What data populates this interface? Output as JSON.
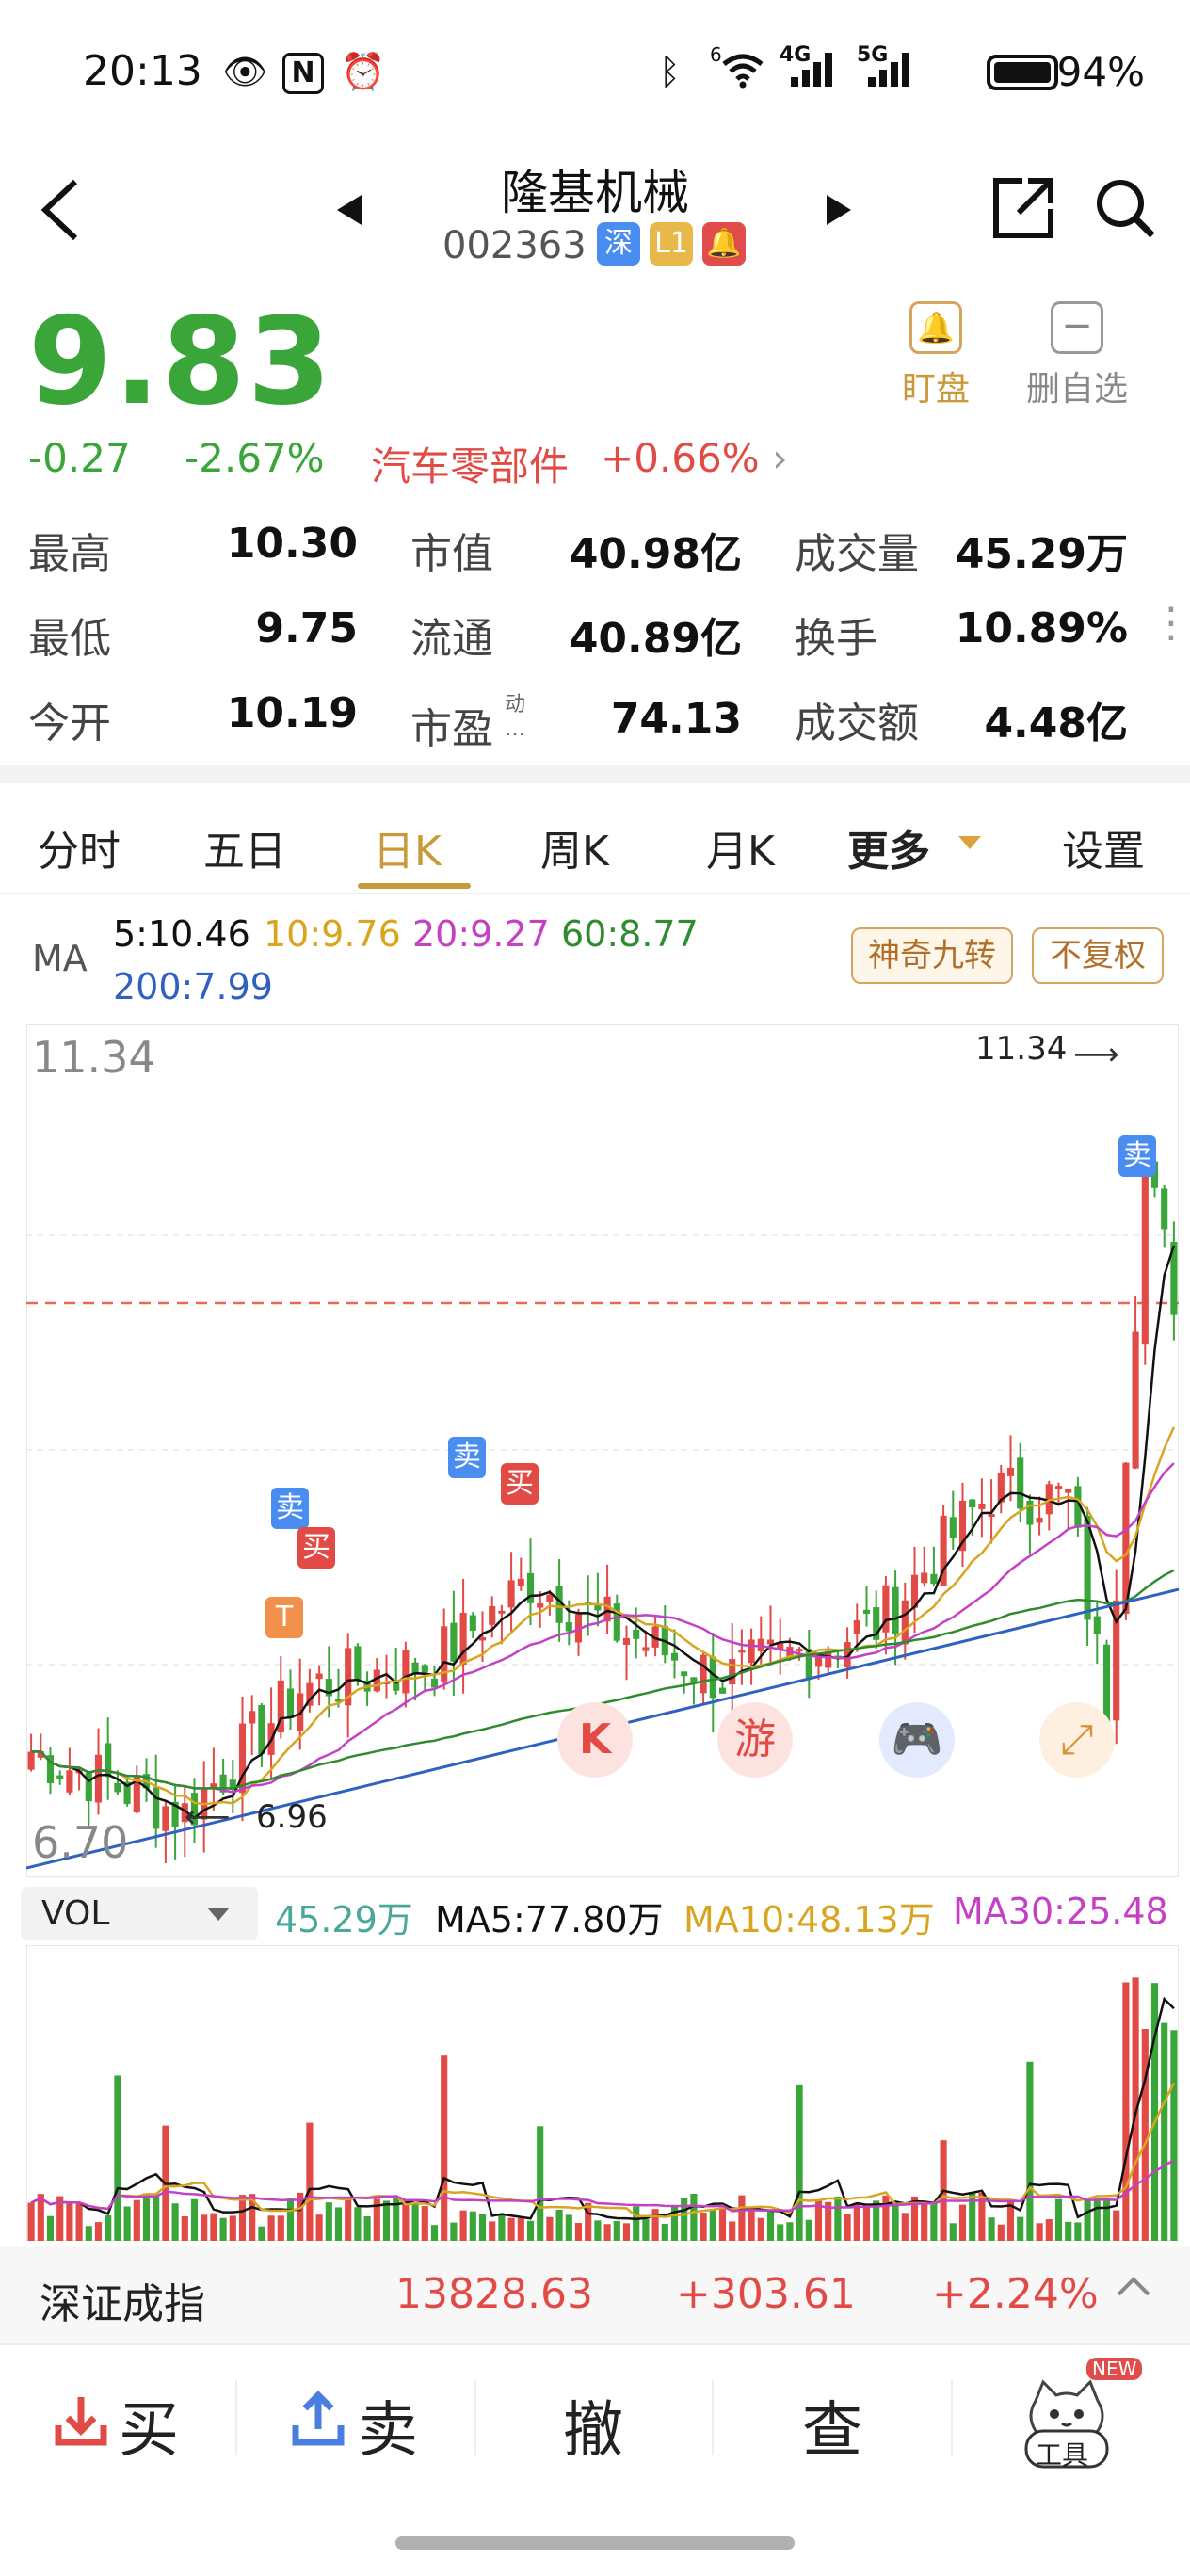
{
  "status_bar": {
    "time": "20:13",
    "icons": [
      "eye-icon",
      "nfc-icon",
      "alarm-icon",
      "bluetooth-icon",
      "wifi-icon",
      "4g-signal-icon",
      "5g-signal-icon",
      "battery-icon"
    ],
    "battery_pct": "94%",
    "net1": "4G",
    "net2": "5G",
    "wifi_badge": "6"
  },
  "header": {
    "stock_name": "隆基机械",
    "stock_code": "002363",
    "tags": [
      "深",
      "L1"
    ],
    "tag_colors": [
      "#4a8df0",
      "#e9b84a",
      "#e04c4c"
    ]
  },
  "quote": {
    "price": "9.83",
    "change": "-0.27",
    "change_pct": "-2.67%",
    "sector": "汽车零部件",
    "sector_change": "+0.66%",
    "watch_label": "盯盘",
    "remove_label": "删自选"
  },
  "stats": [
    {
      "label": "最高",
      "value": "10.30",
      "color": "red"
    },
    {
      "label": "市值",
      "value": "40.98亿",
      "color": "black"
    },
    {
      "label": "成交量",
      "value": "45.29万",
      "color": "black"
    },
    {
      "label": "最低",
      "value": "9.75",
      "color": "green"
    },
    {
      "label": "流通",
      "value": "40.89亿",
      "color": "black"
    },
    {
      "label": "换手",
      "value": "10.89%",
      "color": "black"
    },
    {
      "label": "今开",
      "value": "10.19",
      "color": "red"
    },
    {
      "label": "市盈",
      "value": "74.13",
      "color": "black"
    },
    {
      "label": "成交额",
      "value": "4.48亿",
      "color": "black"
    }
  ],
  "pe_superscript": "动",
  "pe_suffix": "…",
  "tabs": [
    "分时",
    "五日",
    "日K",
    "周K",
    "月K",
    "更多",
    "设置"
  ],
  "active_tab": "日K",
  "ma": {
    "label": "MA",
    "ma5": "5:10.46",
    "ma10": "10:9.76",
    "ma20": "20:9.27",
    "ma60": "60:8.77",
    "ma200": "200:7.99",
    "btn1": "神奇九转",
    "btn2": "不复权"
  },
  "chart": {
    "y_high": "11.34",
    "y_low": "6.70",
    "max_marker": "11.34",
    "min_marker": "6.96",
    "signals": [
      "卖",
      "买",
      "卖",
      "买",
      "T",
      "卖"
    ],
    "floating_buttons": [
      "K",
      "游"
    ]
  },
  "volume": {
    "selector": "VOL",
    "vol": "45.29万",
    "ma5": "MA5:77.80万",
    "ma10": "MA10:48.13万",
    "ma30": "MA30:25.48"
  },
  "index_bar": {
    "name": "深证成指",
    "value": "13828.63",
    "change": "+303.61",
    "change_pct": "+2.24%"
  },
  "actions": {
    "buy": "买",
    "sell": "卖",
    "cancel": "撤",
    "query": "查",
    "tools": "工具",
    "new_badge": "NEW"
  },
  "colors": {
    "up": "#e24a45",
    "down": "#3aa63a",
    "accent": "#c9993a",
    "ma5": "#111111",
    "ma10": "#d9a520",
    "ma20": "#c440c4",
    "ma60": "#2e8b2e",
    "ma200": "#2f62c0"
  }
}
